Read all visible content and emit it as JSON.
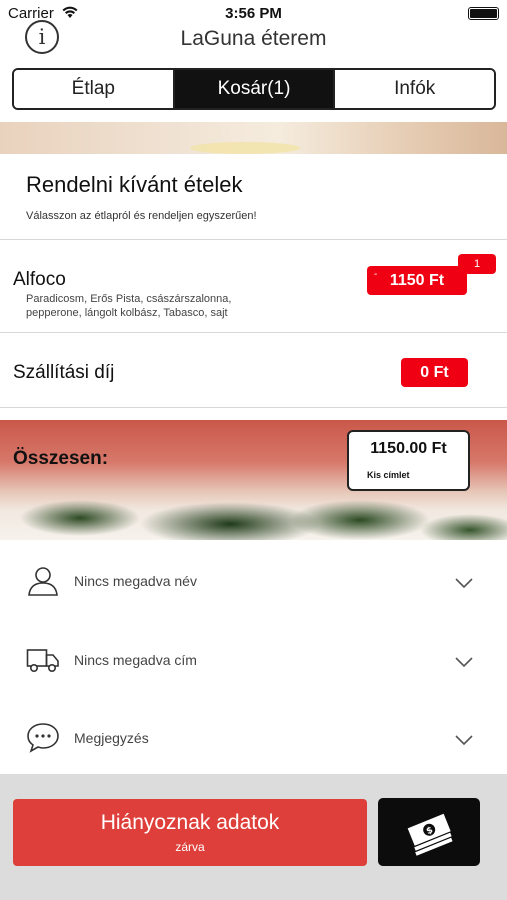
{
  "status_bar": {
    "carrier": "Carrier",
    "time": "3:56 PM"
  },
  "nav": {
    "title": "LaGuna éterem",
    "info_glyph": "i"
  },
  "tabs": [
    {
      "label": "Étlap",
      "active": false
    },
    {
      "label": "Kosár(1)",
      "active": true
    },
    {
      "label": "Infók",
      "active": false
    }
  ],
  "order": {
    "title": "Rendelni kívánt ételek",
    "subtitle": "Válasszon az étlapról és rendeljen egyszerűen!"
  },
  "item": {
    "name": "Alfoco",
    "description": "Paradicosm, Erős Pista, császárszalonna, pepperone, lángolt kolbász, Tabasco, sajt",
    "price": "1150 Ft",
    "minus": "-",
    "quantity": "1"
  },
  "delivery": {
    "label": "Szállítási díj",
    "price": "0 Ft"
  },
  "total": {
    "label": "Összesen:",
    "amount": "1150.00 Ft",
    "note": "Kis címlet"
  },
  "form": {
    "name": {
      "label": "Nincs megadva név",
      "icon": "person-icon"
    },
    "address": {
      "label": "Nincs megadva cím",
      "icon": "truck-icon"
    },
    "note": {
      "label": "Megjegyzés",
      "icon": "speech-bubble-icon"
    }
  },
  "action": {
    "label": "Hiányoznak adatok",
    "sublabel": "zárva",
    "pay_icon": "cash-icon"
  },
  "colors": {
    "accent_red": "#f00013",
    "button_red": "#df3f3a",
    "dark": "#111111"
  }
}
